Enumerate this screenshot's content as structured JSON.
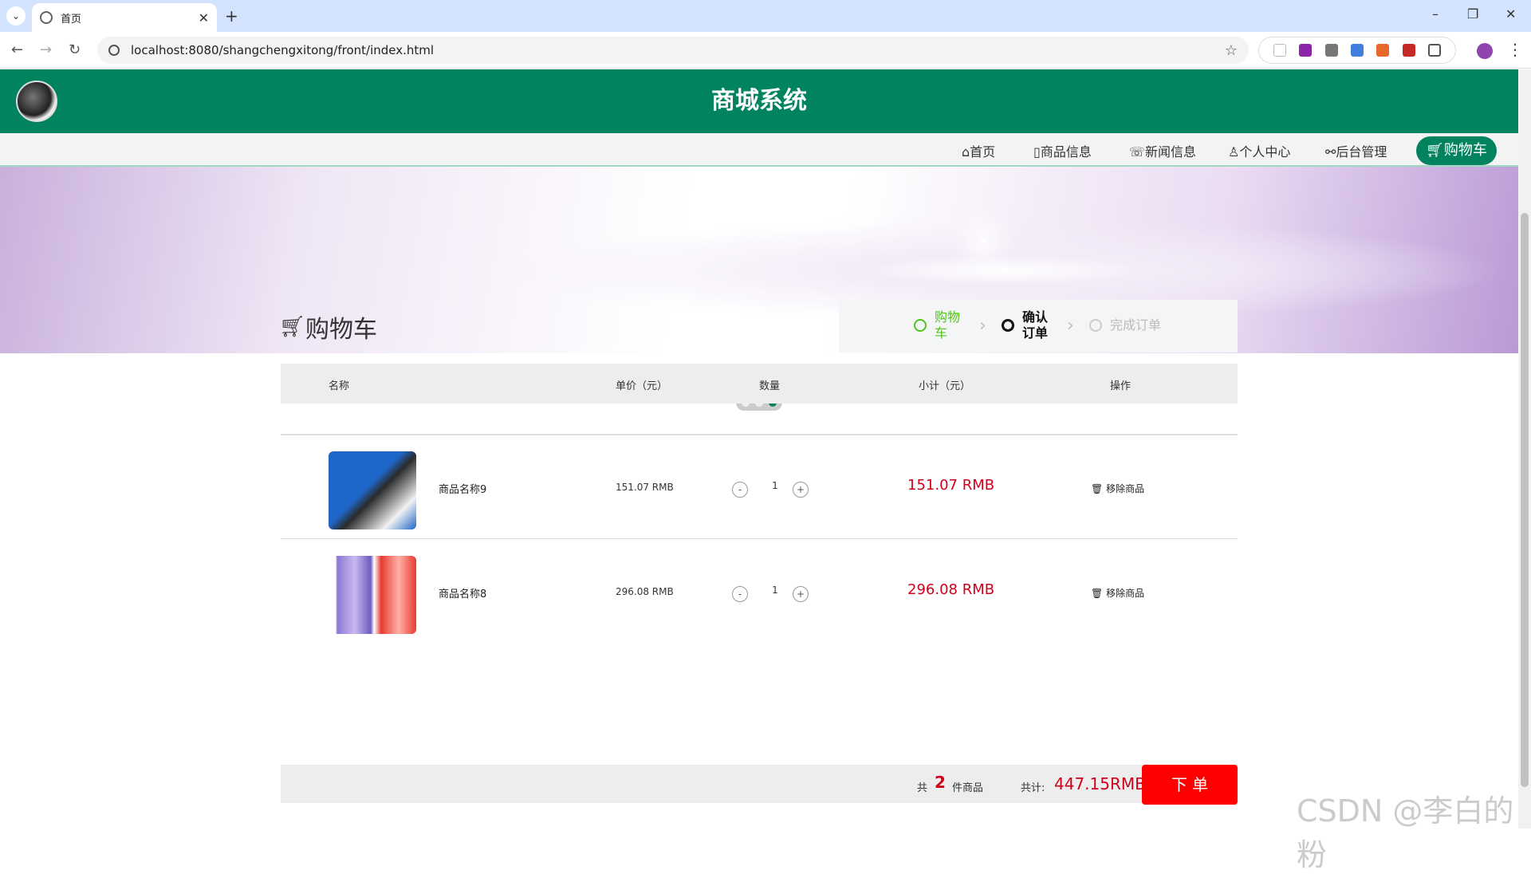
{
  "browser": {
    "tab_title": "首页",
    "url": "localhost:8080/shangchengxitong/front/index.html"
  },
  "header": {
    "site_title": "商城系统"
  },
  "nav": {
    "items": [
      {
        "label": "首页",
        "icon": "home-icon"
      },
      {
        "label": "商品信息",
        "icon": "product-icon"
      },
      {
        "label": "新闻信息",
        "icon": "news-icon"
      },
      {
        "label": "个人中心",
        "icon": "user-icon"
      },
      {
        "label": "后台管理",
        "icon": "link-icon"
      },
      {
        "label": "购物车",
        "icon": "cart-icon",
        "active": true
      }
    ]
  },
  "banner": {
    "slide_count": 3,
    "active_slide": 3
  },
  "cart": {
    "title": "购物车",
    "steps": [
      {
        "label": "购物车",
        "state": "done"
      },
      {
        "label": "确认订单",
        "state": "current"
      },
      {
        "label": "完成订单",
        "state": "pending"
      }
    ],
    "columns": {
      "name": "名称",
      "unit_price": "单价（元）",
      "quantity": "数量",
      "subtotal": "小计（元）",
      "action": "操作"
    },
    "rows": [
      {
        "name": "商品名称9",
        "unit_price": "151.07 RMB",
        "quantity": "1",
        "subtotal": "151.07 RMB",
        "action": "移除商品"
      },
      {
        "name": "商品名称8",
        "unit_price": "296.08 RMB",
        "quantity": "1",
        "subtotal": "296.08 RMB",
        "action": "移除商品"
      }
    ],
    "qty_minus": "-",
    "qty_plus": "+",
    "summary": {
      "prefix": "共",
      "count": "2",
      "suffix": "件商品",
      "total_label": "共计:",
      "total_value": "447.15RMB",
      "order_button": "下 单"
    }
  },
  "watermark": "CSDN @李白的粉",
  "colors": {
    "brand_green": "#00835e",
    "price_red": "#d0021b",
    "order_red": "#ff0000",
    "step_done": "#52c41a"
  }
}
